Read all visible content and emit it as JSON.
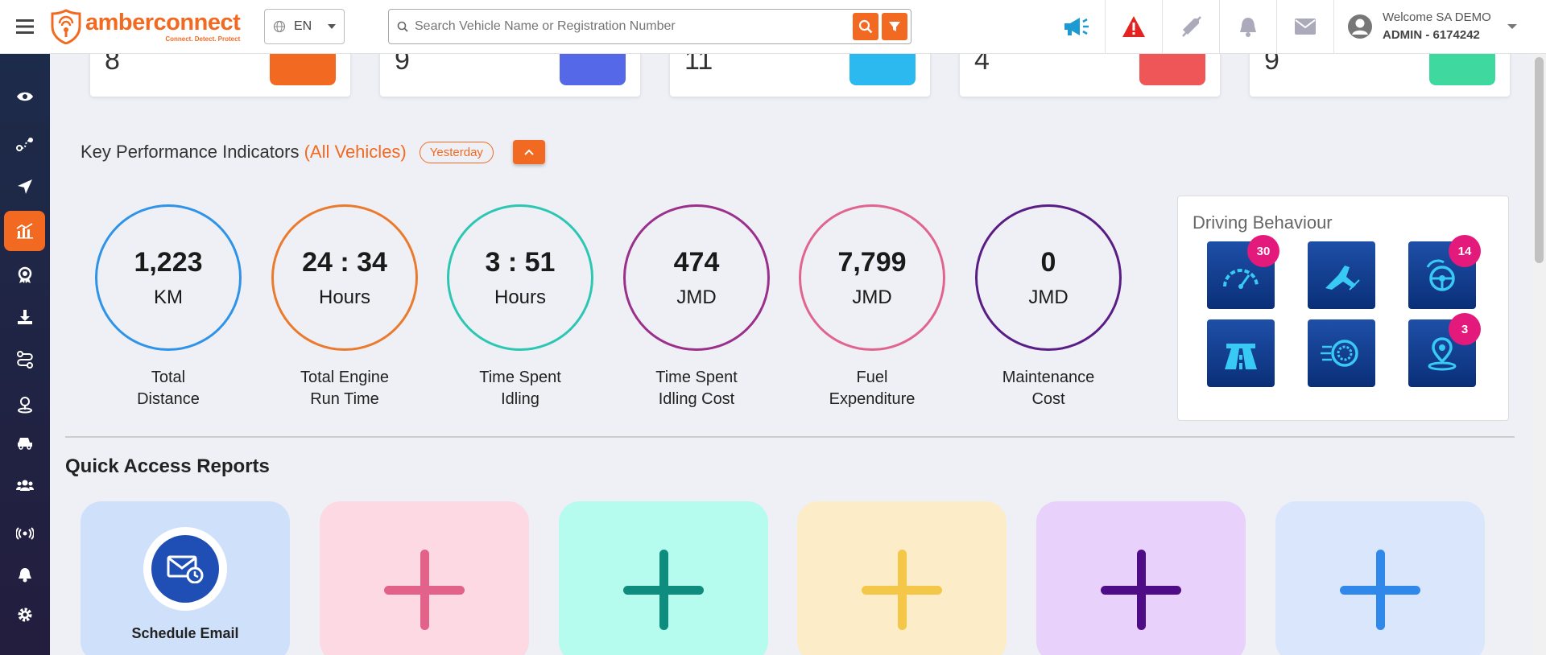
{
  "header": {
    "brand": "amberconnect",
    "tagline": "Connect. Detect. Protect",
    "language": "EN",
    "search_placeholder": "Search Vehicle Name or Registration Number",
    "welcome": "Welcome SA DEMO",
    "user_id": "ADMIN - 6174242",
    "icons": [
      "megaphone-icon",
      "alert-icon",
      "mute-icon",
      "bell-icon",
      "mail-icon",
      "user-avatar-icon"
    ]
  },
  "sidebar": {
    "items": [
      "eye-icon",
      "route-icon",
      "navigate-icon",
      "analytics-icon",
      "award-icon",
      "download-icon",
      "trips-icon",
      "location-icon",
      "vehicle-icon",
      "users-icon",
      "signal-icon",
      "bell-icon",
      "settings-icon"
    ],
    "active_index": 3
  },
  "stats": [
    {
      "value": "8",
      "color": "#f26a21"
    },
    {
      "value": "9",
      "color": "#5468e8"
    },
    {
      "value": "11",
      "color": "#2bb9ef"
    },
    {
      "value": "4",
      "color": "#ef5658"
    },
    {
      "value": "9",
      "color": "#3fd89f"
    }
  ],
  "kpi": {
    "title": "Key Performance Indicators",
    "title_accent": "(All Vehicles)",
    "period": "Yesterday",
    "items": [
      {
        "value": "1,223",
        "unit": "KM",
        "label1": "Total",
        "label2": "Distance",
        "color": "#2f93e8"
      },
      {
        "value": "24 : 34",
        "unit": "Hours",
        "label1": "Total Engine",
        "label2": "Run Time",
        "color": "#ea7b2e"
      },
      {
        "value": "3 : 51",
        "unit": "Hours",
        "label1": "Time Spent",
        "label2": "Idling",
        "color": "#2cc6b3"
      },
      {
        "value": "474",
        "unit": "JMD",
        "label1": "Time Spent",
        "label2": "Idling Cost",
        "color": "#9b2f8c"
      },
      {
        "value": "7,799",
        "unit": "JMD",
        "label1": "Fuel",
        "label2": "Expenditure",
        "color": "#e0648e"
      },
      {
        "value": "0",
        "unit": "JMD",
        "label1": "Maintenance",
        "label2": "Cost",
        "color": "#5a1d86"
      }
    ]
  },
  "driving": {
    "title": "Driving Behaviour",
    "tiles": [
      {
        "icon": "speedometer-icon",
        "badge": "30"
      },
      {
        "icon": "harsh-brake-icon",
        "badge": ""
      },
      {
        "icon": "steering-icon",
        "badge": "14"
      },
      {
        "icon": "highway-icon",
        "badge": ""
      },
      {
        "icon": "acceleration-icon",
        "badge": ""
      },
      {
        "icon": "geofence-icon",
        "badge": "3"
      }
    ]
  },
  "quick_access": {
    "title": "Quick Access Reports",
    "cards": [
      {
        "label": "Schedule Email",
        "bg": "#cfe0fb"
      },
      {
        "label": "",
        "bg": "#fdd9e3",
        "plus": "#e36289"
      },
      {
        "label": "",
        "bg": "#b5fbee",
        "plus": "#0e8d7f"
      },
      {
        "label": "",
        "bg": "#fdecc8",
        "plus": "#f4c748"
      },
      {
        "label": "",
        "bg": "#e8d1fb",
        "plus": "#4e0d86"
      },
      {
        "label": "",
        "bg": "#dae6fb",
        "plus": "#2f88ea"
      }
    ]
  }
}
